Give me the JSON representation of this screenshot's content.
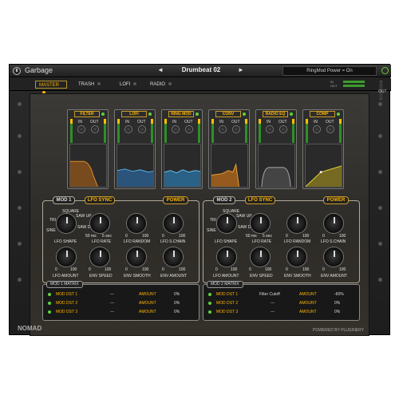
{
  "app": {
    "title": "Garbage"
  },
  "top": {
    "preset": "Drumbeat 02",
    "status": "RingMod Power = On",
    "prev_arrow": "◄",
    "next_arrow": "►"
  },
  "tabs": [
    {
      "label": "MASTER",
      "active": true
    },
    {
      "label": "TRASH",
      "active": false
    },
    {
      "label": "LOFI",
      "active": false
    },
    {
      "label": "RADIO",
      "active": false
    }
  ],
  "meter": {
    "in_label": "IN",
    "out_label": "OUT",
    "master_out": "OUT"
  },
  "effects": [
    {
      "name": "FILTER",
      "in": "IN",
      "out": "OUT"
    },
    {
      "name": "LOFI",
      "in": "IN",
      "out": "OUT"
    },
    {
      "name": "RING MOD",
      "in": "IN",
      "out": "OUT"
    },
    {
      "name": "CONV",
      "in": "IN",
      "out": "OUT"
    },
    {
      "name": "RADIO EQ",
      "in": "IN",
      "out": "OUT"
    },
    {
      "name": "COMP",
      "in": "IN",
      "out": "OUT"
    }
  ],
  "mod1": {
    "title": "MOD 1",
    "lfo_sync": "LFO SYNC",
    "power": "POWER",
    "shapes": {
      "square": "SQUARE",
      "saw_up": "SAW UP",
      "tri": "TRI",
      "saw_dn": "SAW DN",
      "sine": "SINE"
    },
    "lfo_shape": "LFO SHAPE",
    "lfo_rate": "LFO RATE",
    "lfo_random": "LFO RANDOM",
    "lfo_schain": "LFO S.CHAIN",
    "rate_min": "50 ms",
    "rate_max": "5 sec",
    "zero": "0",
    "hundred": "100",
    "lfo_amount": "LFO AMOUNT",
    "env_speed": "ENV SPEED",
    "env_smooth": "ENV SMOOTH",
    "env_amount": "ENV AMOUNT"
  },
  "mod2": {
    "title": "MOD 2",
    "lfo_sync": "LFO SYNC",
    "power": "POWER",
    "shapes": {
      "square": "SQUARE",
      "saw_up": "SAW UP",
      "tri": "TRI",
      "saw_dn": "SAW DN",
      "sine": "SINE"
    },
    "lfo_shape": "LFO SHAPE",
    "lfo_rate": "LFO RATE",
    "lfo_random": "LFO RANDOM",
    "lfo_schain": "LFO S.CHAIN",
    "rate_min": "50 ms",
    "rate_max": "5 sec",
    "zero": "0",
    "hundred": "100",
    "lfo_amount": "LFO AMOUNT",
    "env_speed": "ENV SPEED",
    "env_smooth": "ENV SMOOTH",
    "env_amount": "ENV AMOUNT"
  },
  "matrix1": {
    "title": "MOD 1 MATRIX",
    "rows": [
      {
        "dst": "MOD DST 1",
        "target": "---",
        "amount": "AMOUNT",
        "value": "0%"
      },
      {
        "dst": "MOD DST 2",
        "target": "---",
        "amount": "AMOUNT",
        "value": "0%"
      },
      {
        "dst": "MOD DST 3",
        "target": "---",
        "amount": "AMOUNT",
        "value": "0%"
      }
    ]
  },
  "matrix2": {
    "title": "MOD 2 MATRIX",
    "rows": [
      {
        "dst": "MOD DST 1",
        "target": "Filter Cutoff",
        "amount": "AMOUNT",
        "value": "-60%"
      },
      {
        "dst": "MOD DST 2",
        "target": "---",
        "amount": "AMOUNT",
        "value": "0%"
      },
      {
        "dst": "MOD DST 3",
        "target": "---",
        "amount": "AMOUNT",
        "value": "0%"
      }
    ]
  },
  "footer": {
    "brand": "NOMAD",
    "powered": "POWERED BY PLUGINERY"
  },
  "colors": {
    "accent": "#ffb400",
    "led": "#5fd23c",
    "graph_orange": "#d9821f",
    "graph_blue": "#3c8fd6"
  }
}
